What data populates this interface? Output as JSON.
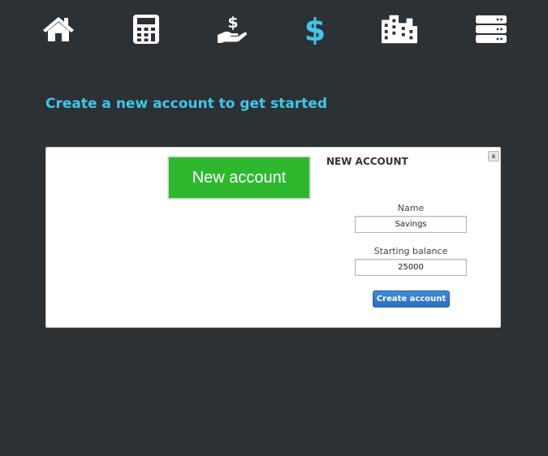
{
  "nav": {
    "items": [
      {
        "icon": "home-icon",
        "color": "#ffffff"
      },
      {
        "icon": "calculator-icon",
        "color": "#ffffff"
      },
      {
        "icon": "hand-holding-dollar-icon",
        "color": "#ffffff"
      },
      {
        "icon": "dollar-sign-icon",
        "color": "#41c6ea",
        "active": true
      },
      {
        "icon": "building-icon",
        "color": "#ffffff"
      },
      {
        "icon": "server-icon",
        "color": "#ffffff"
      }
    ]
  },
  "main": {
    "headline": "Create a new account to get started"
  },
  "panel": {
    "new_account_label": "New account",
    "form": {
      "title": "NEW ACCOUNT",
      "close_label": "x",
      "name_label": "Name",
      "name_value": "Savings",
      "balance_label": "Starting balance",
      "balance_value": "25000",
      "submit_label": "Create account"
    }
  },
  "colors": {
    "background": "#2c3136",
    "accent": "#41c6ea",
    "new_account_green": "#2eb82e",
    "button_blue": "#2a6fc0"
  }
}
